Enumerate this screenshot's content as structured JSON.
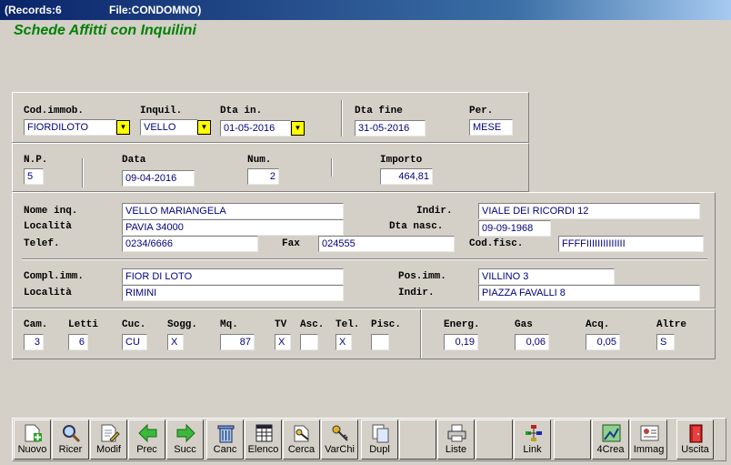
{
  "titlebar": {
    "records": "(Records:6",
    "file": "File:CONDOMNO)"
  },
  "heading": "Schede Affitti con Inquilini",
  "row1": {
    "cod_immob_label": "Cod.immob.",
    "cod_immob_value": "FIORDILOTO",
    "inquil_label": "Inquil.",
    "inquil_value": "VELLO",
    "dta_in_label": "Dta in.",
    "dta_in_value": "01-05-2016",
    "dta_fine_label": "Dta fine",
    "dta_fine_value": "31-05-2016",
    "per_label": "Per.",
    "per_value": "MESE"
  },
  "row2": {
    "np_label": "N.P.",
    "np_value": "5",
    "data_label": "Data",
    "data_value": "09-04-2016",
    "num_label": "Num.",
    "num_value": "2",
    "importo_label": "Importo",
    "importo_value": "464,81"
  },
  "tenant": {
    "nome_label": "Nome inq.",
    "nome_value": "VELLO MARIANGELA",
    "indir_label": "Indir.",
    "indir_value": "VIALE DEI RICORDI 12",
    "localita_label": "Località",
    "localita_value": "PAVIA  34000",
    "dta_nasc_label": "Dta nasc.",
    "dta_nasc_value": "09-09-1968",
    "telef_label": "Telef.",
    "telef_value": "0234/6666",
    "fax_label": "Fax",
    "fax_value": "024555",
    "cod_fisc_label": "Cod.fisc.",
    "cod_fisc_value": "FFFFIIIIIIIIIIIIII"
  },
  "building": {
    "compl_label": "Compl.imm.",
    "compl_value": "FIOR DI LOTO",
    "pos_label": "Pos.imm.",
    "pos_value": "VILLINO 3",
    "localita_label": "Località",
    "localita_value": "RIMINI",
    "indir_label": "Indir.",
    "indir_value": "PIAZZA FAVALLI 8"
  },
  "features": {
    "cam_label": "Cam.",
    "cam_value": "3",
    "letti_label": "Letti",
    "letti_value": "6",
    "cuc_label": "Cuc.",
    "cuc_value": "CU",
    "sogg_label": "Sogg.",
    "sogg_value": "X",
    "mq_label": "Mq.",
    "mq_value": "87",
    "tv_label": "TV",
    "tv_value": "X",
    "asc_label": "Asc.",
    "asc_value": "",
    "tel_label": "Tel.",
    "tel_value": "X",
    "pisc_label": "Pisc.",
    "pisc_value": ""
  },
  "costs": {
    "energ_label": "Energ.",
    "energ_value": "0,19",
    "gas_label": "Gas",
    "gas_value": "0,06",
    "acq_label": "Acq.",
    "acq_value": "0,05",
    "altre_label": "Altre",
    "altre_value": "S"
  },
  "toolbar": [
    {
      "label": "Nuovo",
      "icon": "new-icon"
    },
    {
      "label": "Ricer",
      "icon": "search-icon"
    },
    {
      "label": "Modif",
      "icon": "edit-icon"
    },
    {
      "label": "Prec",
      "icon": "arrow-left-icon"
    },
    {
      "label": "Succ",
      "icon": "arrow-right-icon"
    },
    {
      "label": "Canc",
      "icon": "trash-icon"
    },
    {
      "label": "Elenco",
      "icon": "list-icon"
    },
    {
      "label": "Cerca",
      "icon": "find-icon"
    },
    {
      "label": "VarChi",
      "icon": "key-icon"
    },
    {
      "label": "Dupl",
      "icon": "duplicate-icon"
    },
    {
      "label": "",
      "icon": ""
    },
    {
      "label": "Liste",
      "icon": "printer-icon"
    },
    {
      "label": "",
      "icon": ""
    },
    {
      "label": "Link",
      "icon": "link-icon"
    },
    {
      "label": "",
      "icon": ""
    },
    {
      "label": "4Crea",
      "icon": "create-icon"
    },
    {
      "label": "Immag",
      "icon": "image-icon"
    },
    {
      "label": "Uscita",
      "icon": "exit-icon"
    }
  ]
}
